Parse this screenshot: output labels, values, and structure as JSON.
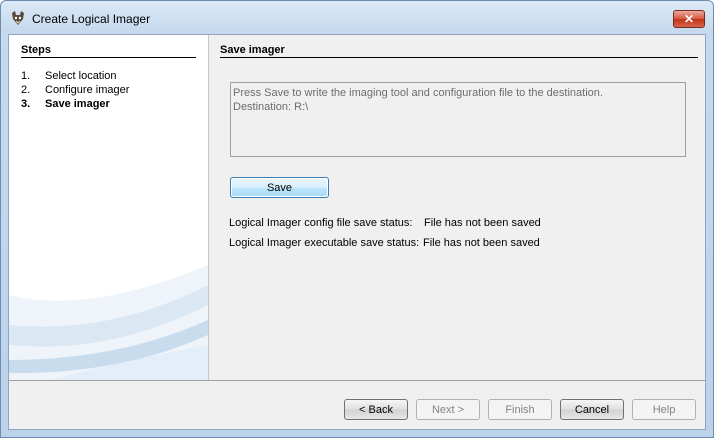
{
  "window": {
    "title": "Create Logical Imager",
    "close_label": "✕"
  },
  "steps": {
    "title": "Steps",
    "items": [
      {
        "num": "1.",
        "label": "Select location"
      },
      {
        "num": "2.",
        "label": "Configure imager"
      },
      {
        "num": "3.",
        "label": "Save imager"
      }
    ]
  },
  "content": {
    "title": "Save imager",
    "info_line1": "Press Save to write the imaging tool and configuration file to the destination.",
    "info_line2": "Destination: R:\\",
    "save_label": "Save",
    "config_status_label": "Logical Imager config file save status:",
    "config_status_value": "File has not been saved",
    "exe_status_label": "Logical Imager executable save status:",
    "exe_status_value": "File has not been saved"
  },
  "footer": {
    "back_label": "< Back",
    "next_label": "Next >",
    "finish_label": "Finish",
    "cancel_label": "Cancel",
    "help_label": "Help"
  }
}
